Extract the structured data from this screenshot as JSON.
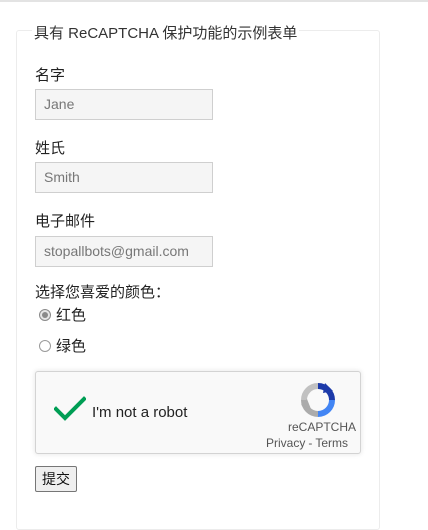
{
  "form": {
    "legend": "具有 ReCAPTCHA 保护功能的示例表单",
    "fields": [
      {
        "label": "名字",
        "value": "Jane"
      },
      {
        "label": "姓氏",
        "value": "Smith"
      },
      {
        "label": "电子邮件",
        "value": "stopallbots@gmail.com"
      }
    ],
    "color_question": "选择您喜爱的颜色：",
    "color_options": [
      {
        "label": "红色",
        "selected": true
      },
      {
        "label": "绿色",
        "selected": false
      }
    ],
    "submit_label": "提交"
  },
  "captcha": {
    "label": "I'm not a robot",
    "checked": true,
    "brand": "reCAPTCHA",
    "privacy": "Privacy",
    "separator": "-",
    "terms": "Terms",
    "check_color": "#009e55",
    "icon": "recaptcha-logo-icon"
  }
}
